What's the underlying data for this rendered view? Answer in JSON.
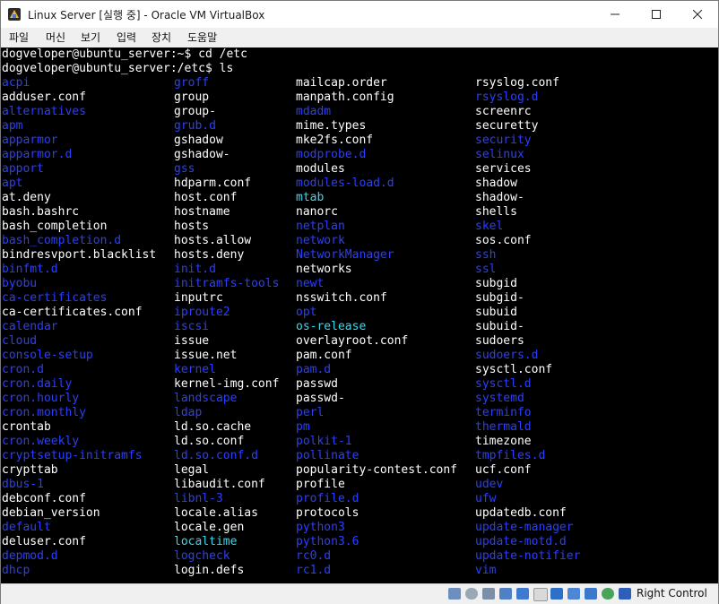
{
  "window": {
    "title": "Linux Server [실행 중] - Oracle VM VirtualBox"
  },
  "menu": [
    "파일",
    "머신",
    "보기",
    "입력",
    "장치",
    "도움말"
  ],
  "terminal": {
    "lines": [
      "dogveloper@ubuntu_server:~$ cd /etc",
      "dogveloper@ubuntu_server:/etc$ ls"
    ],
    "columns": [
      [
        {
          "name": "acpi",
          "kind": "dir"
        },
        {
          "name": "adduser.conf",
          "kind": "file"
        },
        {
          "name": "alternatives",
          "kind": "dir"
        },
        {
          "name": "apm",
          "kind": "dir"
        },
        {
          "name": "apparmor",
          "kind": "dir"
        },
        {
          "name": "apparmor.d",
          "kind": "dir"
        },
        {
          "name": "apport",
          "kind": "dir"
        },
        {
          "name": "apt",
          "kind": "dir"
        },
        {
          "name": "at.deny",
          "kind": "file"
        },
        {
          "name": "bash.bashrc",
          "kind": "file"
        },
        {
          "name": "bash_completion",
          "kind": "file"
        },
        {
          "name": "bash_completion.d",
          "kind": "dir"
        },
        {
          "name": "bindresvport.blacklist",
          "kind": "file"
        },
        {
          "name": "binfmt.d",
          "kind": "dir"
        },
        {
          "name": "byobu",
          "kind": "dir"
        },
        {
          "name": "ca-certificates",
          "kind": "dir"
        },
        {
          "name": "ca-certificates.conf",
          "kind": "file"
        },
        {
          "name": "calendar",
          "kind": "dir"
        },
        {
          "name": "cloud",
          "kind": "dir"
        },
        {
          "name": "console-setup",
          "kind": "dir"
        },
        {
          "name": "cron.d",
          "kind": "dir"
        },
        {
          "name": "cron.daily",
          "kind": "dir"
        },
        {
          "name": "cron.hourly",
          "kind": "dir"
        },
        {
          "name": "cron.monthly",
          "kind": "dir"
        },
        {
          "name": "crontab",
          "kind": "file"
        },
        {
          "name": "cron.weekly",
          "kind": "dir"
        },
        {
          "name": "cryptsetup-initramfs",
          "kind": "dir"
        },
        {
          "name": "crypttab",
          "kind": "file"
        },
        {
          "name": "dbus-1",
          "kind": "dir"
        },
        {
          "name": "debconf.conf",
          "kind": "file"
        },
        {
          "name": "debian_version",
          "kind": "file"
        },
        {
          "name": "default",
          "kind": "dir"
        },
        {
          "name": "deluser.conf",
          "kind": "file"
        },
        {
          "name": "depmod.d",
          "kind": "dir"
        },
        {
          "name": "dhcp",
          "kind": "dir"
        }
      ],
      [
        {
          "name": "groff",
          "kind": "dir"
        },
        {
          "name": "group",
          "kind": "file"
        },
        {
          "name": "group-",
          "kind": "file"
        },
        {
          "name": "grub.d",
          "kind": "dir"
        },
        {
          "name": "gshadow",
          "kind": "file"
        },
        {
          "name": "gshadow-",
          "kind": "file"
        },
        {
          "name": "gss",
          "kind": "dir"
        },
        {
          "name": "hdparm.conf",
          "kind": "file"
        },
        {
          "name": "host.conf",
          "kind": "file"
        },
        {
          "name": "hostname",
          "kind": "file"
        },
        {
          "name": "hosts",
          "kind": "file"
        },
        {
          "name": "hosts.allow",
          "kind": "file"
        },
        {
          "name": "hosts.deny",
          "kind": "file"
        },
        {
          "name": "init.d",
          "kind": "dir"
        },
        {
          "name": "initramfs-tools",
          "kind": "dir"
        },
        {
          "name": "inputrc",
          "kind": "file"
        },
        {
          "name": "iproute2",
          "kind": "dir"
        },
        {
          "name": "iscsi",
          "kind": "dir"
        },
        {
          "name": "issue",
          "kind": "file"
        },
        {
          "name": "issue.net",
          "kind": "file"
        },
        {
          "name": "kernel",
          "kind": "dir"
        },
        {
          "name": "kernel-img.conf",
          "kind": "file"
        },
        {
          "name": "landscape",
          "kind": "dir"
        },
        {
          "name": "ldap",
          "kind": "dir"
        },
        {
          "name": "ld.so.cache",
          "kind": "file"
        },
        {
          "name": "ld.so.conf",
          "kind": "file"
        },
        {
          "name": "ld.so.conf.d",
          "kind": "dir"
        },
        {
          "name": "legal",
          "kind": "file"
        },
        {
          "name": "libaudit.conf",
          "kind": "file"
        },
        {
          "name": "libnl-3",
          "kind": "dir"
        },
        {
          "name": "locale.alias",
          "kind": "file"
        },
        {
          "name": "locale.gen",
          "kind": "file"
        },
        {
          "name": "localtime",
          "kind": "link"
        },
        {
          "name": "logcheck",
          "kind": "dir"
        },
        {
          "name": "login.defs",
          "kind": "file"
        }
      ],
      [
        {
          "name": "mailcap.order",
          "kind": "file"
        },
        {
          "name": "manpath.config",
          "kind": "file"
        },
        {
          "name": "mdadm",
          "kind": "dir"
        },
        {
          "name": "mime.types",
          "kind": "file"
        },
        {
          "name": "mke2fs.conf",
          "kind": "file"
        },
        {
          "name": "modprobe.d",
          "kind": "dir"
        },
        {
          "name": "modules",
          "kind": "file"
        },
        {
          "name": "modules-load.d",
          "kind": "dir"
        },
        {
          "name": "mtab",
          "kind": "link"
        },
        {
          "name": "nanorc",
          "kind": "file"
        },
        {
          "name": "netplan",
          "kind": "dir"
        },
        {
          "name": "network",
          "kind": "dir"
        },
        {
          "name": "NetworkManager",
          "kind": "dir"
        },
        {
          "name": "networks",
          "kind": "file"
        },
        {
          "name": "newt",
          "kind": "dir"
        },
        {
          "name": "nsswitch.conf",
          "kind": "file"
        },
        {
          "name": "opt",
          "kind": "dir"
        },
        {
          "name": "os-release",
          "kind": "link"
        },
        {
          "name": "overlayroot.conf",
          "kind": "file"
        },
        {
          "name": "pam.conf",
          "kind": "file"
        },
        {
          "name": "pam.d",
          "kind": "dir"
        },
        {
          "name": "passwd",
          "kind": "file"
        },
        {
          "name": "passwd-",
          "kind": "file"
        },
        {
          "name": "perl",
          "kind": "dir"
        },
        {
          "name": "pm",
          "kind": "dir"
        },
        {
          "name": "polkit-1",
          "kind": "dir"
        },
        {
          "name": "pollinate",
          "kind": "dir"
        },
        {
          "name": "popularity-contest.conf",
          "kind": "file"
        },
        {
          "name": "profile",
          "kind": "file"
        },
        {
          "name": "profile.d",
          "kind": "dir"
        },
        {
          "name": "protocols",
          "kind": "file"
        },
        {
          "name": "python3",
          "kind": "dir"
        },
        {
          "name": "python3.6",
          "kind": "dir"
        },
        {
          "name": "rc0.d",
          "kind": "dir"
        },
        {
          "name": "rc1.d",
          "kind": "dir"
        }
      ],
      [
        {
          "name": "rsyslog.conf",
          "kind": "file"
        },
        {
          "name": "rsyslog.d",
          "kind": "dir"
        },
        {
          "name": "screenrc",
          "kind": "file"
        },
        {
          "name": "securetty",
          "kind": "file"
        },
        {
          "name": "security",
          "kind": "dir"
        },
        {
          "name": "selinux",
          "kind": "dir"
        },
        {
          "name": "services",
          "kind": "file"
        },
        {
          "name": "shadow",
          "kind": "file"
        },
        {
          "name": "shadow-",
          "kind": "file"
        },
        {
          "name": "shells",
          "kind": "file"
        },
        {
          "name": "skel",
          "kind": "dir"
        },
        {
          "name": "sos.conf",
          "kind": "file"
        },
        {
          "name": "ssh",
          "kind": "dir"
        },
        {
          "name": "ssl",
          "kind": "dir"
        },
        {
          "name": "subgid",
          "kind": "file"
        },
        {
          "name": "subgid-",
          "kind": "file"
        },
        {
          "name": "subuid",
          "kind": "file"
        },
        {
          "name": "subuid-",
          "kind": "file"
        },
        {
          "name": "sudoers",
          "kind": "file"
        },
        {
          "name": "sudoers.d",
          "kind": "dir"
        },
        {
          "name": "sysctl.conf",
          "kind": "file"
        },
        {
          "name": "sysctl.d",
          "kind": "dir"
        },
        {
          "name": "systemd",
          "kind": "dir"
        },
        {
          "name": "terminfo",
          "kind": "dir"
        },
        {
          "name": "thermald",
          "kind": "dir"
        },
        {
          "name": "timezone",
          "kind": "file"
        },
        {
          "name": "tmpfiles.d",
          "kind": "dir"
        },
        {
          "name": "ucf.conf",
          "kind": "file"
        },
        {
          "name": "udev",
          "kind": "dir"
        },
        {
          "name": "ufw",
          "kind": "dir"
        },
        {
          "name": "updatedb.conf",
          "kind": "file"
        },
        {
          "name": "update-manager",
          "kind": "dir"
        },
        {
          "name": "update-motd.d",
          "kind": "dir"
        },
        {
          "name": "update-notifier",
          "kind": "dir"
        },
        {
          "name": "vim",
          "kind": "dir"
        }
      ]
    ]
  },
  "colors": {
    "file": "#ffffff",
    "dir": "#2a3fff",
    "link": "#3ad8ee"
  },
  "statusbar": {
    "icons": [
      "hard-disk-icon",
      "optical-drive-icon",
      "audio-icon",
      "network-icon",
      "usb-icon",
      "shared-folders-icon",
      "display-icon",
      "video-capture-icon",
      "recording-icon",
      "virtualization-icon",
      "mouse-integration-icon"
    ],
    "host_key": "Right Control"
  }
}
